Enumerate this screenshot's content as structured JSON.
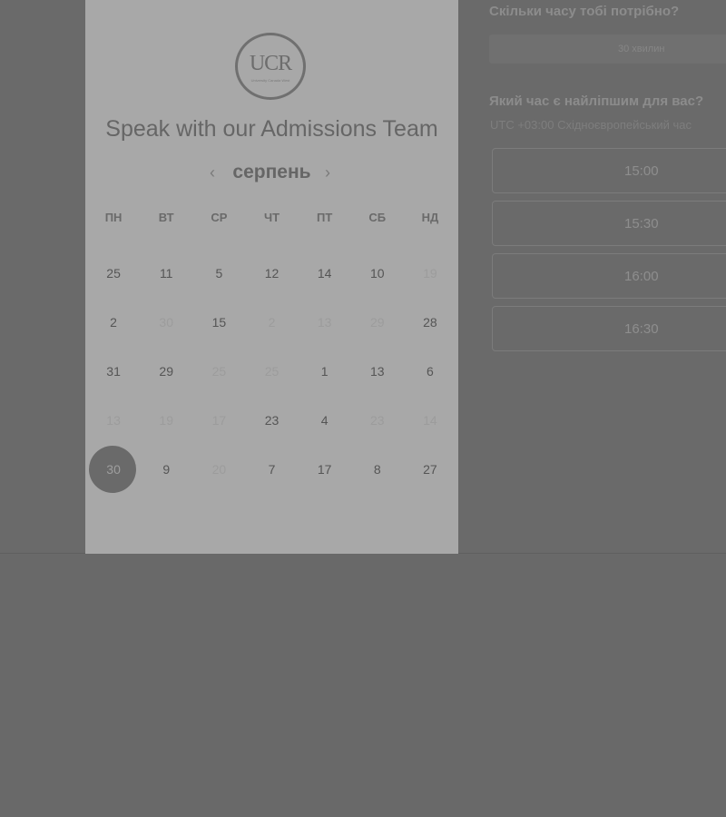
{
  "logo": {
    "text": "UCR",
    "subtext": "University Canada West"
  },
  "title": "Speak with our Admissions Team",
  "calendar": {
    "month": "серпень",
    "prev_icon": "chevron-left-icon",
    "next_icon": "chevron-right-icon",
    "weekdays": [
      "ПН",
      "ВТ",
      "СР",
      "ЧТ",
      "ПТ",
      "СБ",
      "НД"
    ],
    "rows": [
      [
        {
          "d": "25",
          "m": false
        },
        {
          "d": "11",
          "m": false
        },
        {
          "d": "5",
          "m": false
        },
        {
          "d": "12",
          "m": false
        },
        {
          "d": "14",
          "m": false
        },
        {
          "d": "10",
          "m": false
        },
        {
          "d": "19",
          "m": true
        }
      ],
      [
        {
          "d": "2",
          "m": false
        },
        {
          "d": "30",
          "m": true
        },
        {
          "d": "15",
          "m": false
        },
        {
          "d": "2",
          "m": true
        },
        {
          "d": "13",
          "m": true
        },
        {
          "d": "29",
          "m": true
        },
        {
          "d": "28",
          "m": false
        }
      ],
      [
        {
          "d": "31",
          "m": false
        },
        {
          "d": "29",
          "m": false
        },
        {
          "d": "25",
          "m": true
        },
        {
          "d": "25",
          "m": true
        },
        {
          "d": "1",
          "m": false
        },
        {
          "d": "13",
          "m": false
        },
        {
          "d": "6",
          "m": false
        }
      ],
      [
        {
          "d": "13",
          "m": true
        },
        {
          "d": "19",
          "m": true
        },
        {
          "d": "17",
          "m": true
        },
        {
          "d": "23",
          "m": false
        },
        {
          "d": "4",
          "m": false
        },
        {
          "d": "23",
          "m": true
        },
        {
          "d": "14",
          "m": true
        }
      ],
      [
        {
          "d": "30",
          "m": false,
          "sel": true
        },
        {
          "d": "9",
          "m": false
        },
        {
          "d": "20",
          "m": true
        },
        {
          "d": "7",
          "m": false
        },
        {
          "d": "17",
          "m": false
        },
        {
          "d": "8",
          "m": false
        },
        {
          "d": "27",
          "m": false
        }
      ]
    ]
  },
  "right": {
    "duration_question": "Скільки часу тобі потрібно?",
    "duration_value": "30 хвилин",
    "time_question": "Який час є найліпшим для вас?",
    "timezone": "UTC +03:00 Східноєвропейський час",
    "slots": [
      "15:00",
      "15:30",
      "16:00",
      "16:30"
    ]
  }
}
